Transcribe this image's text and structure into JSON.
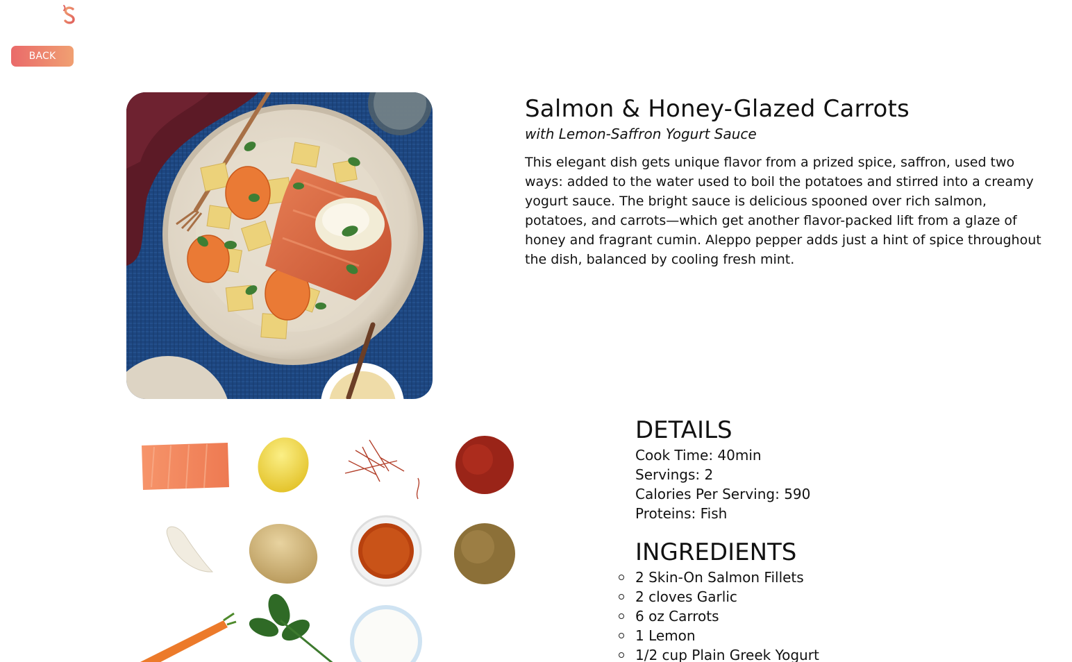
{
  "header": {
    "logo_icon": "sprig-logo-icon",
    "back_label": "BACK",
    "accent_gradient": [
      "#ea6a6a",
      "#f0a072"
    ]
  },
  "recipe": {
    "title": "Salmon & Honey-Glazed Carrots",
    "subtitle": "with Lemon-Saffron Yogurt Sauce",
    "description": "This elegant dish gets unique flavor from a prized spice, saffron, used two ways: added to the water used to boil the potatoes and stirred into a creamy yogurt sauce. The bright sauce is delicious spooned over rich salmon, potatoes, and carrots—which get another flavor-packed lift from a glaze of honey and fragrant cumin. Aleppo pepper adds just a hint of spice throughout the dish, balanced by cooling fresh mint."
  },
  "images": {
    "hero": "plated-salmon-dish-photo",
    "ingredient_photos": [
      "salmon",
      "lemon",
      "saffron",
      "aleppo-pepper",
      "garlic",
      "potato",
      "honey",
      "cumin",
      "carrot",
      "mint",
      "yogurt"
    ]
  },
  "details": {
    "heading": "DETAILS",
    "cook_time": "Cook Time: 40min",
    "servings": "Servings: 2",
    "calories": "Calories Per Serving: 590",
    "proteins": "Proteins: Fish"
  },
  "ingredients": {
    "heading": "INGREDIENTS",
    "items": [
      "2 Skin-On Salmon Fillets",
      "2 cloves Garlic",
      "6 oz Carrots",
      "1 Lemon",
      "1/2 cup Plain Greek Yogurt"
    ]
  }
}
